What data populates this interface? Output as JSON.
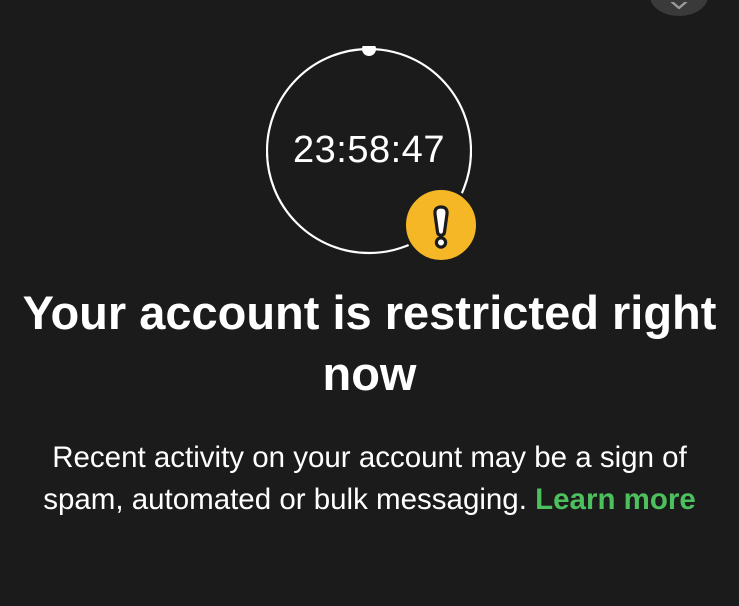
{
  "timer": {
    "value": "23:58:47"
  },
  "restriction": {
    "title": "Your account is restricted right now",
    "description": "Recent activity on your account may be a sign of spam, automated or bulk messaging.",
    "learn_more_label": "Learn more"
  },
  "colors": {
    "background": "#1b1b1b",
    "warning": "#f5b726",
    "link": "#4cc05d",
    "text": "#ffffff"
  },
  "icons": {
    "close": "close-icon",
    "warning": "exclamation-icon"
  }
}
